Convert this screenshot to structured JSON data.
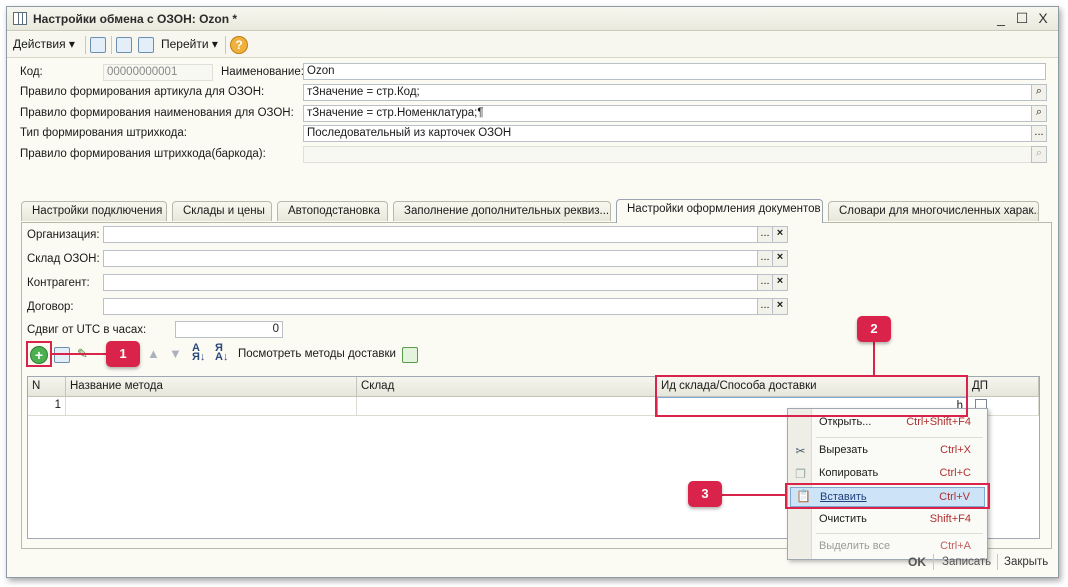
{
  "window": {
    "title": "Настройки обмена с ОЗОН: Ozon *",
    "controls": [
      "_",
      "☐",
      "X"
    ]
  },
  "toolbar": {
    "actions_label": "Действия",
    "goto_label": "Перейти"
  },
  "form": {
    "code_label": "Код:",
    "code_value": "00000000001",
    "name_label": "Наименование:",
    "name_value": "Ozon",
    "article_rule_label": "Правило формирования артикула для ОЗОН:",
    "article_rule_value": "тЗначение = стр.Код;",
    "name_rule_label": "Правило формирования наименования для ОЗОН:",
    "name_rule_value": "тЗначение = стр.Номенклатура;¶",
    "barcode_type_label": "Тип формирования штрихкода:",
    "barcode_type_value": "Последовательный из карточек ОЗОН",
    "barcode_rule_label": "Правило формирования штрихкода(баркода):",
    "barcode_rule_value": ""
  },
  "tabs": [
    {
      "label": "Настройки подключения"
    },
    {
      "label": "Склады и цены"
    },
    {
      "label": "Автоподстановка"
    },
    {
      "label": "Заполнение дополнительных реквиз..."
    },
    {
      "label": "Настройки оформления документов"
    },
    {
      "label": "Словари для многочисленных харак..."
    }
  ],
  "docsettings": {
    "org_label": "Организация:",
    "warehouse_label": "Склад ОЗОН:",
    "contractor_label": "Контрагент:",
    "contract_label": "Договор:",
    "utc_label": "Сдвиг от UTC в часах:",
    "utc_value": "0",
    "view_methods_label": "Посмотреть методы доставки"
  },
  "grid": {
    "headers": [
      "N",
      "Название метода",
      "Склад",
      "Ид склада/Способа доставки",
      "ДП"
    ],
    "rows": [
      {
        "n": "1",
        "name": "",
        "warehouse": "",
        "id": "h"
      }
    ]
  },
  "context_menu": {
    "items": [
      {
        "label": "Открыть...",
        "shortcut": "Ctrl+Shift+F4"
      },
      {
        "label": "Вырезать",
        "shortcut": "Ctrl+X"
      },
      {
        "label": "Копировать",
        "shortcut": "Ctrl+C"
      },
      {
        "label": "Вставить",
        "shortcut": "Ctrl+V"
      },
      {
        "label": "Очистить",
        "shortcut": "Shift+F4"
      },
      {
        "label": "Выделить все",
        "shortcut": "Ctrl+A"
      }
    ]
  },
  "callouts": [
    "1",
    "2",
    "3"
  ],
  "footer": {
    "ok": "OK",
    "save": "Записать",
    "close": "Закрыть"
  },
  "colors": {
    "callout": "#d9234a",
    "window_bg": "#fbfbf3",
    "menu_highlight": "#cde3f8"
  }
}
